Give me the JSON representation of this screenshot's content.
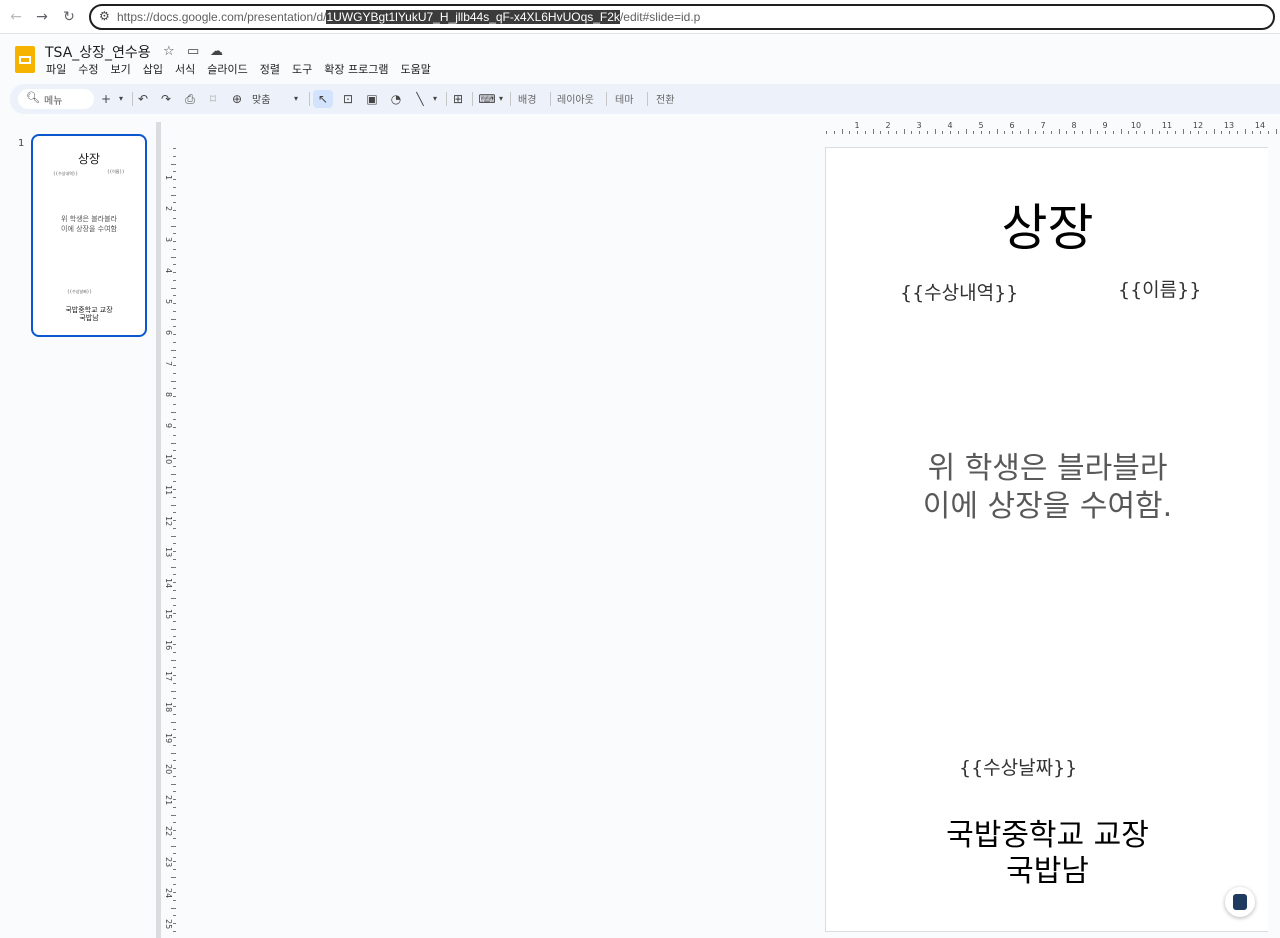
{
  "browser": {
    "url_prefix": "https://docs.google.com/presentation/d/",
    "url_selected": "1UWGYBgt1lYukU7_H_jllb44s_qF-x4XL6HvUOqs_F2k",
    "url_suffix": "/edit#slide=id.p"
  },
  "app": {
    "title": "TSA_상장_연수용",
    "menu": [
      "파일",
      "수정",
      "보기",
      "삽입",
      "서식",
      "슬라이드",
      "정렬",
      "도구",
      "확장 프로그램",
      "도움말"
    ]
  },
  "toolbar": {
    "search_label": "메뉴",
    "zoom_label": "맞춤",
    "background": "배경",
    "layout": "레이아웃",
    "theme": "테마",
    "transition": "전환"
  },
  "filmstrip": {
    "slide_number": "1"
  },
  "slide": {
    "title": "상장",
    "award": "{{수상내역}}",
    "name": "{{이름}}",
    "body_line1": "위 학생은 블라블라",
    "body_line2": "이에 상장을 수여함.",
    "date": "{{수상날짜}}",
    "signer_line1": "국밥중학교 교장",
    "signer_line2": "국밥남"
  },
  "thumbnail": {
    "body_line1": "위 학생은 블라블라",
    "body_line2": "이에 상장을 수여함"
  },
  "rulers": {
    "horizontal": [
      "1",
      "2",
      "3",
      "4",
      "5",
      "6",
      "7",
      "8",
      "9",
      "10",
      "11",
      "12",
      "13",
      "14"
    ],
    "vertical": [
      "1",
      "2",
      "3",
      "4",
      "5",
      "6",
      "7",
      "8",
      "9",
      "10",
      "11",
      "12",
      "13",
      "14",
      "15",
      "16",
      "17",
      "18",
      "19",
      "20",
      "21",
      "22",
      "23",
      "24",
      "25"
    ]
  },
  "colors": {
    "accent": "#0b57d0",
    "slides_logo": "#f6b400",
    "toolbar_bg": "#edf2fa"
  }
}
